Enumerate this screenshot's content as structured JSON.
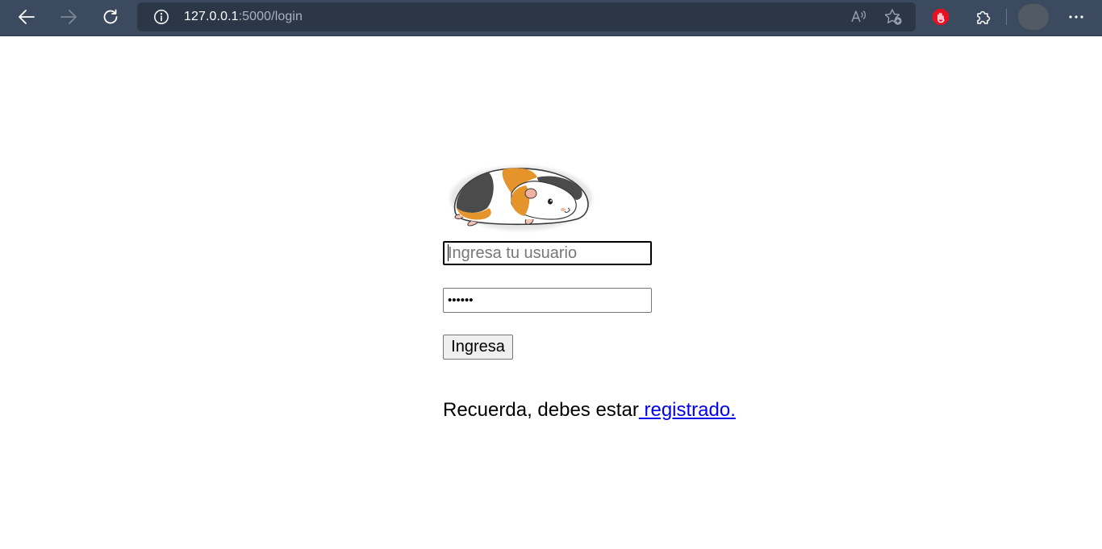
{
  "browser": {
    "url_host": "127.0.0.1",
    "url_rest": ":5000/login",
    "icons": {
      "back": "back-arrow-icon",
      "forward": "forward-arrow-icon",
      "refresh": "refresh-icon",
      "site_info": "info-icon",
      "read_aloud": "read-aloud-icon",
      "favorites": "add-favorite-icon",
      "extension_block": "stop-hand-icon",
      "extensions": "puzzle-icon",
      "menu": "more-dots-icon"
    },
    "colors": {
      "toolbar": "#3b4a5e",
      "address_bar": "#2b3646",
      "block_extension": "#e81123"
    }
  },
  "login": {
    "logo": "guinea-pig-logo",
    "username_placeholder": "Ingresa tu usuario",
    "password_value": "••••••",
    "submit_label": "Ingresa",
    "reminder_text": "Recuerda, debes estar",
    "register_link": " registrado."
  }
}
